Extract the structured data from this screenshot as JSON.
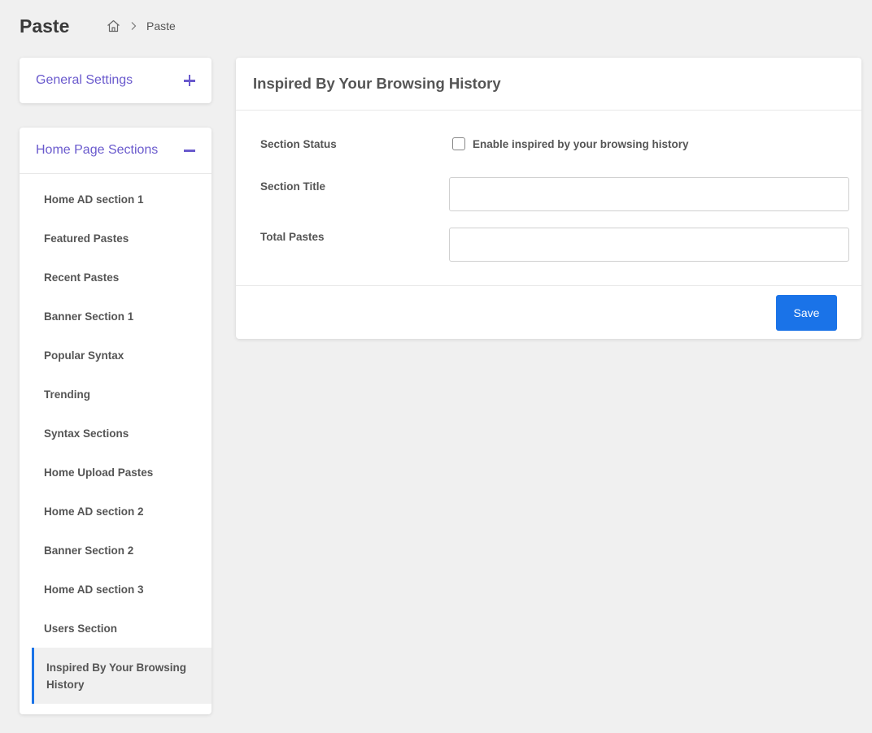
{
  "page": {
    "title": "Paste"
  },
  "breadcrumb": {
    "home_icon": "home-icon",
    "separator_icon": "chevron-right-icon",
    "current": "Paste"
  },
  "sidebar": {
    "general": {
      "title": "General Settings",
      "icon": "plus-icon"
    },
    "home": {
      "title": "Home Page Sections",
      "icon": "minus-icon",
      "items": [
        {
          "label": "Home AD section 1"
        },
        {
          "label": "Featured Pastes"
        },
        {
          "label": "Recent Pastes"
        },
        {
          "label": "Banner Section 1"
        },
        {
          "label": "Popular Syntax"
        },
        {
          "label": "Trending"
        },
        {
          "label": "Syntax Sections"
        },
        {
          "label": "Home Upload Pastes"
        },
        {
          "label": "Home AD section 2"
        },
        {
          "label": "Banner Section 2"
        },
        {
          "label": "Home AD section 3"
        },
        {
          "label": "Users Section"
        },
        {
          "label": "Inspired By Your Browsing History"
        }
      ],
      "active_index": 12
    }
  },
  "main": {
    "title": "Inspired By Your Browsing History",
    "section_status_label": "Section Status",
    "checkbox_label": "Enable inspired by your browsing history",
    "checkbox_checked": false,
    "section_title_label": "Section Title",
    "section_title_value": "",
    "total_pastes_label": "Total Pastes",
    "total_pastes_value": "",
    "save_label": "Save"
  },
  "colors": {
    "accent": "#6a5acd",
    "primary": "#1a73e8",
    "background": "#f0f0f0"
  }
}
